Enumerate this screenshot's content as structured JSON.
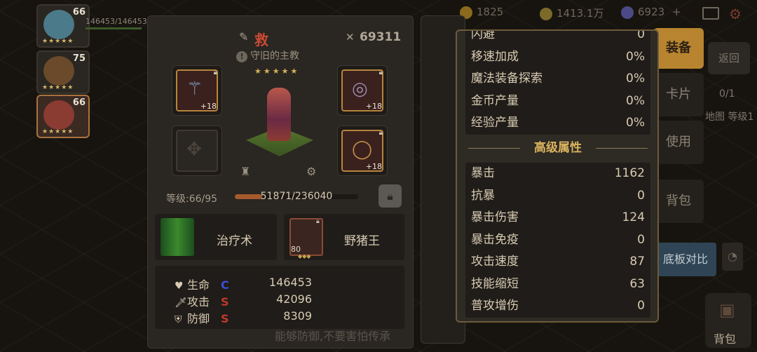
{
  "resources": {
    "r1": "1825",
    "r2": "1413.1万",
    "r3": "6923",
    "plus": "+"
  },
  "hero_list": [
    {
      "level": "66",
      "stars": "★★★★★"
    },
    {
      "level": "75",
      "stars": "★★★★★"
    },
    {
      "level": "66",
      "stars": "★★★★★"
    }
  ],
  "hero_hp_text": "146453/146453",
  "hero": {
    "name": "救",
    "power": "69311",
    "title": "守旧的主教",
    "stars": "★★★★★",
    "level_label": "等级:66/95",
    "xp_text": "51871/236040",
    "xp_fraction": 0.22
  },
  "equipment": {
    "weapon_plus": "+18",
    "ring_plus": "+18",
    "amulet_plus": "+18"
  },
  "skills": {
    "skill1": "治疗术",
    "skill2": "野猪王",
    "skill2_level": "80"
  },
  "stats": [
    {
      "name": "生命",
      "grade": "C",
      "grade_color": "#3d4fd6",
      "value": "146453"
    },
    {
      "name": "攻击",
      "grade": "S",
      "grade_color": "#c0392b",
      "value": "42096"
    },
    {
      "name": "防御",
      "grade": "S",
      "grade_color": "#c0392b",
      "value": "8309"
    }
  ],
  "bottom_text": "能够防御,不要害怕传承",
  "side_buttons": {
    "equip": "装备",
    "card": "卡片",
    "use": "使用",
    "bag": "背包",
    "compare": "底板对比",
    "return": "返回",
    "count": "0/1",
    "map_level": "地图 等级1",
    "bag_bottom": "背包"
  },
  "attributes": {
    "basic": [
      {
        "name": "闪避",
        "value": "0"
      },
      {
        "name": "移速加成",
        "value": "0%"
      },
      {
        "name": "魔法装备探索",
        "value": "0%"
      },
      {
        "name": "金币产量",
        "value": "0%"
      },
      {
        "name": "经验产量",
        "value": "0%"
      }
    ],
    "advanced_title": "高级属性",
    "advanced": [
      {
        "name": "暴击",
        "value": "1162"
      },
      {
        "name": "抗暴",
        "value": "0"
      },
      {
        "name": "暴击伤害",
        "value": "124"
      },
      {
        "name": "暴击免疫",
        "value": "0"
      },
      {
        "name": "攻击速度",
        "value": "87"
      },
      {
        "name": "技能缩短",
        "value": "63"
      },
      {
        "name": "普攻增伤",
        "value": "0"
      }
    ]
  }
}
